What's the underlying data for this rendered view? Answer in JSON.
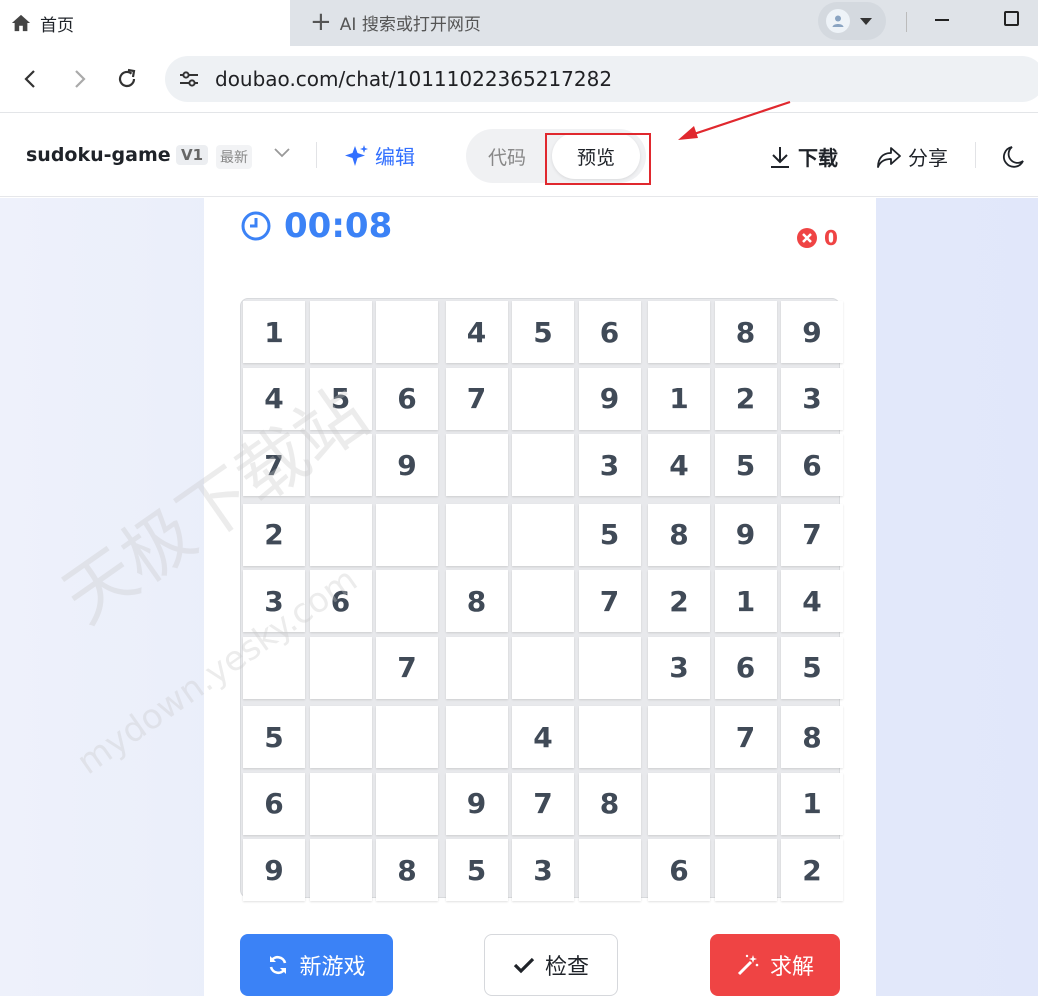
{
  "browser": {
    "tab_title": "首页",
    "new_tab_label": "AI 搜索或打开网页",
    "url": "doubao.com/chat/10111022365217282"
  },
  "app": {
    "project_name": "sudoku-game",
    "version": "V1",
    "version_tag": "最新",
    "edit_label": "编辑",
    "toggle": {
      "code_label": "代码",
      "preview_label": "预览",
      "selected": "预览"
    },
    "download_label": "下载",
    "share_label": "分享"
  },
  "game": {
    "timer": "00:08",
    "error_count": "0",
    "board": [
      [
        "1",
        "",
        "",
        "4",
        "5",
        "6",
        "",
        "8",
        "9"
      ],
      [
        "4",
        "5",
        "6",
        "7",
        "",
        "9",
        "1",
        "2",
        "3"
      ],
      [
        "7",
        "",
        "9",
        "",
        "",
        "3",
        "4",
        "5",
        "6"
      ],
      [
        "2",
        "",
        "",
        "",
        "",
        "5",
        "8",
        "9",
        "7"
      ],
      [
        "3",
        "6",
        "",
        "8",
        "",
        "7",
        "2",
        "1",
        "4"
      ],
      [
        "",
        "",
        "7",
        "",
        "",
        "",
        "3",
        "6",
        "5"
      ],
      [
        "5",
        "",
        "",
        "",
        "4",
        "",
        "",
        "7",
        "8"
      ],
      [
        "6",
        "",
        "",
        "9",
        "7",
        "8",
        "",
        "",
        "1"
      ],
      [
        "9",
        "",
        "8",
        "5",
        "3",
        "",
        "6",
        "",
        "2"
      ]
    ],
    "buttons": {
      "new_game": "新游戏",
      "check": "检查",
      "solve": "求解"
    }
  },
  "watermark": {
    "text": "天极下载站",
    "url_text": "mydown.yesky.com"
  },
  "colors": {
    "accent": "#3b82f6",
    "danger": "#ef4444",
    "annotation": "#e0282e"
  },
  "icons": [
    "home-icon",
    "plus-icon",
    "back-icon",
    "forward-icon",
    "reload-icon",
    "tune-icon",
    "sparkle-icon",
    "download-icon",
    "share-icon",
    "moon-icon",
    "clock-icon",
    "error-icon",
    "refresh-icon",
    "check-icon",
    "magic-wand-icon"
  ]
}
